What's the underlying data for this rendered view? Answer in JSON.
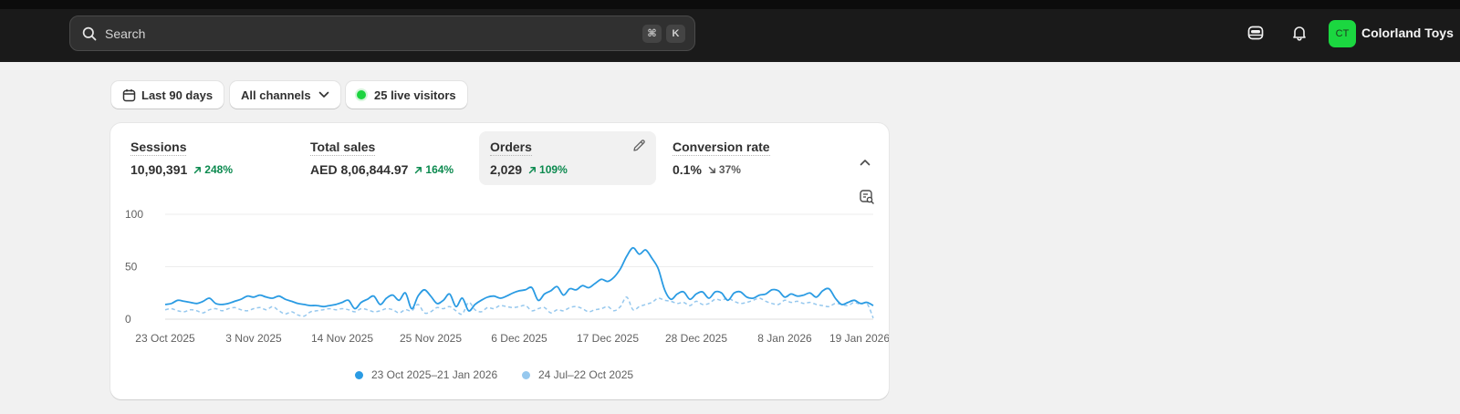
{
  "header": {
    "search": {
      "placeholder": "Search",
      "shortcut_keys": [
        "⌘",
        "K"
      ]
    },
    "icons": [
      "search-icon",
      "store-switch-icon",
      "bell-icon"
    ],
    "store": {
      "avatar_initials": "CT",
      "avatar_color": "#1bd740",
      "name": "Colorland Toys"
    }
  },
  "filters": {
    "date_range": "Last 90 days",
    "channel": "All channels",
    "live_visitors": "25 live visitors",
    "live_color": "#1cd43f"
  },
  "metrics": [
    {
      "label": "Sessions",
      "value": "10,90,391",
      "delta": "248%",
      "direction": "up"
    },
    {
      "label": "Total sales",
      "value": "AED 8,06,844.97",
      "delta": "164%",
      "direction": "up"
    },
    {
      "label": "Orders",
      "value": "2,029",
      "delta": "109%",
      "direction": "up",
      "active": true
    },
    {
      "label": "Conversion rate",
      "value": "0.1%",
      "delta": "37%",
      "direction": "down"
    }
  ],
  "chart_data": {
    "type": "line",
    "metric": "Orders",
    "ylim": [
      0,
      100
    ],
    "y_ticks": [
      0,
      50,
      100
    ],
    "x_tick_labels": [
      "23 Oct 2025",
      "3 Nov 2025",
      "14 Nov 2025",
      "25 Nov 2025",
      "6 Dec 2025",
      "17 Dec 2025",
      "28 Dec 2025",
      "8 Jan 2026",
      "19 Jan 2026"
    ],
    "grid": true,
    "legend_position": "bottom",
    "series": [
      {
        "name": "23 Oct 2025–21 Jan 2026",
        "color": "#2a9be3",
        "style": "solid",
        "values": [
          14,
          15,
          18,
          17,
          16,
          15,
          17,
          20,
          15,
          14,
          15,
          17,
          19,
          22,
          21,
          23,
          21,
          20,
          22,
          19,
          17,
          15,
          14,
          13,
          13,
          12,
          13,
          14,
          16,
          18,
          10,
          16,
          19,
          22,
          14,
          20,
          23,
          18,
          25,
          10,
          22,
          28,
          22,
          15,
          18,
          24,
          12,
          20,
          8,
          14,
          18,
          21,
          22,
          20,
          22,
          25,
          27,
          28,
          30,
          18,
          24,
          27,
          31,
          23,
          29,
          28,
          32,
          30,
          34,
          38,
          36,
          40,
          48,
          60,
          68,
          62,
          66,
          58,
          48,
          28,
          19,
          24,
          26,
          19,
          24,
          26,
          20,
          26,
          25,
          18,
          25,
          26,
          21,
          20,
          23,
          24,
          28,
          27,
          21,
          24,
          22,
          23,
          25,
          21,
          27,
          29,
          20,
          14,
          16,
          18,
          15,
          16,
          13
        ]
      },
      {
        "name": "24 Jul–22 Oct 2025",
        "color": "#96c8ee",
        "style": "dashed",
        "values": [
          9,
          10,
          8,
          7,
          9,
          8,
          6,
          9,
          10,
          8,
          10,
          11,
          9,
          8,
          10,
          11,
          9,
          12,
          8,
          5,
          7,
          4,
          3,
          7,
          8,
          9,
          10,
          9,
          10,
          9,
          7,
          10,
          9,
          7,
          8,
          10,
          9,
          6,
          9,
          8,
          14,
          6,
          7,
          11,
          10,
          12,
          8,
          5,
          16,
          9,
          7,
          11,
          10,
          13,
          12,
          11,
          12,
          13,
          8,
          10,
          11,
          6,
          9,
          8,
          11,
          12,
          10,
          7,
          9,
          10,
          12,
          8,
          12,
          21,
          9,
          12,
          14,
          16,
          20,
          18,
          17,
          15,
          16,
          13,
          17,
          14,
          15,
          19,
          18,
          20,
          17,
          15,
          16,
          18,
          20,
          17,
          15,
          14,
          18,
          16,
          17,
          15,
          16,
          14,
          13,
          12,
          15,
          14,
          13,
          16,
          14,
          15,
          1
        ]
      }
    ]
  }
}
